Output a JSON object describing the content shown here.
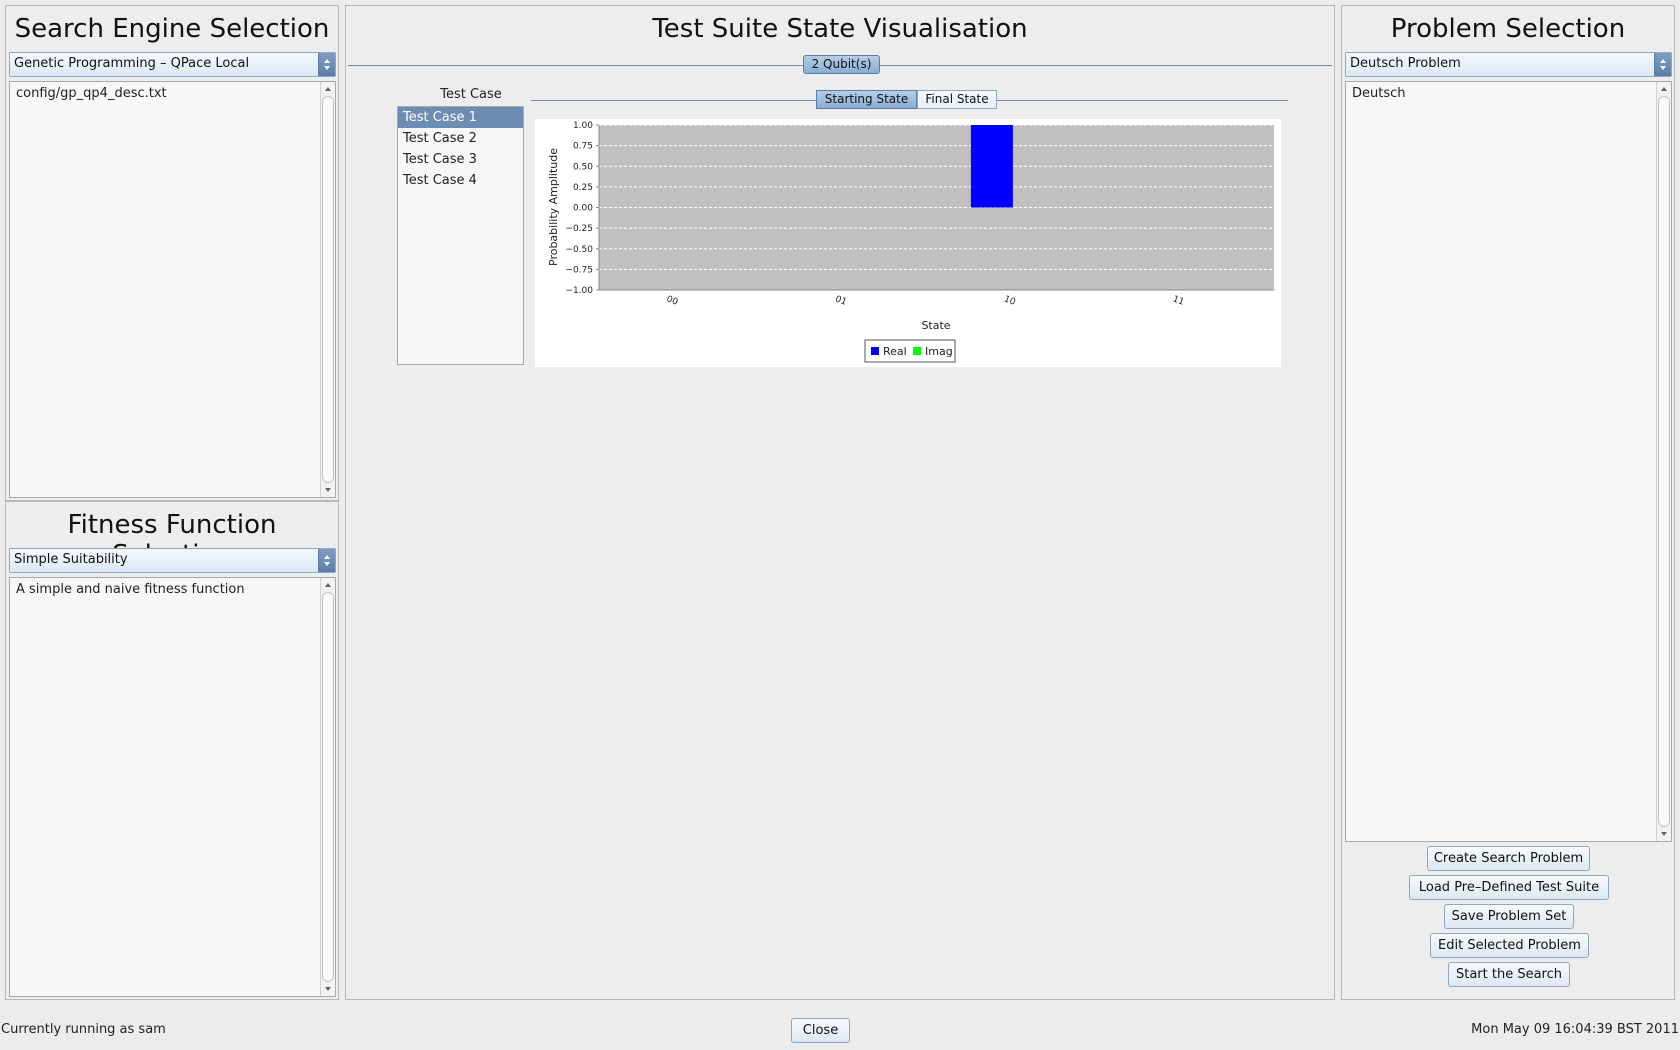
{
  "search_engine": {
    "title": "Search Engine Selection",
    "selected": "Genetic Programming – QPace Local",
    "description": "config/gp_qp4_desc.txt"
  },
  "fitness": {
    "title": "Fitness Function Selection",
    "selected": "Simple Suitability",
    "description": "A simple and naive fitness function"
  },
  "visualisation": {
    "title": "Test Suite State Visualisation",
    "qubit_tab": "2 Qubit(s)",
    "test_case_header": "Test Case",
    "test_cases": [
      "Test Case 1",
      "Test Case 2",
      "Test Case 3",
      "Test Case 4"
    ],
    "selected_test_case": 0,
    "state_tabs": [
      "Starting State",
      "Final State"
    ],
    "selected_state_tab": 0
  },
  "problem": {
    "title": "Problem Selection",
    "selected": "Deutsch Problem",
    "description": "Deutsch",
    "buttons": [
      "Create Search Problem",
      "Load Pre–Defined Test Suite",
      "Save Problem Set",
      "Edit Selected Problem",
      "Start the Search"
    ]
  },
  "footer": {
    "user_status": "Currently running as sam",
    "close_label": "Close",
    "datetime": "Mon May 09 16:04:39 BST 2011"
  },
  "chart_data": {
    "type": "bar",
    "categories": [
      "00",
      "01",
      "10",
      "11"
    ],
    "series": [
      {
        "name": "Real",
        "color": "#0000ff",
        "values": [
          0,
          0,
          1,
          0
        ]
      },
      {
        "name": "Imag",
        "color": "#00ff00",
        "values": [
          0,
          0,
          0,
          0
        ]
      }
    ],
    "xlabel": "State",
    "ylabel": "Probability Amplitude",
    "ylim": [
      -1,
      1
    ],
    "yticks": [
      "1.00",
      "0.75",
      "0.50",
      "0.25",
      "0.00",
      "−0.25",
      "−0.50",
      "−0.75",
      "−1.00"
    ],
    "grid": true,
    "legend": "bottom-center",
    "plot_background": "#c0c0c0"
  }
}
